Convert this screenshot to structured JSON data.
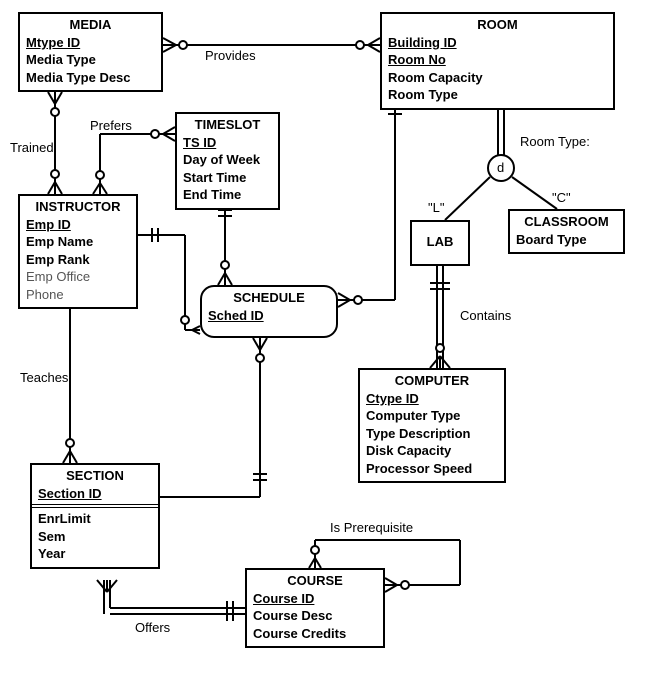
{
  "entities": {
    "media": {
      "title": "MEDIA",
      "pk": "Mtype ID",
      "attrs": [
        "Media Type",
        "Media Type Desc"
      ]
    },
    "room": {
      "title": "ROOM",
      "pk1": "Building ID",
      "pk2": "Room No",
      "attrs": [
        "Room Capacity",
        "Room Type"
      ]
    },
    "timeslot": {
      "title": "TIMESLOT",
      "pk": "TS ID",
      "attrs": [
        "Day of Week",
        "Start Time",
        "End Time"
      ]
    },
    "instructor": {
      "title": "INSTRUCTOR",
      "pk": "Emp ID",
      "attrs": [
        "Emp Name",
        "Emp Rank"
      ],
      "opt": "Emp Office Phone"
    },
    "schedule": {
      "title": "SCHEDULE",
      "pk": "Sched ID"
    },
    "lab": {
      "title": "LAB"
    },
    "classroom": {
      "title": "CLASSROOM",
      "attr": "Board Type"
    },
    "computer": {
      "title": "COMPUTER",
      "pk": "Ctype ID",
      "attrs": [
        "Computer Type",
        "Type Description",
        "Disk Capacity",
        "Processor Speed"
      ]
    },
    "section": {
      "title": "SECTION",
      "pk": "Section ID",
      "attrs": [
        "EnrLimit",
        "Sem",
        "Year"
      ]
    },
    "course": {
      "title": "COURSE",
      "pk": "Course ID",
      "attrs": [
        "Course Desc",
        "Course Credits"
      ]
    }
  },
  "relationships": {
    "provides": "Provides",
    "trained": "Trained",
    "prefers": "Prefers",
    "teaches": "Teaches",
    "offers": "Offers",
    "contains": "Contains",
    "is_prerequisite": "Is Prerequisite",
    "room_type_discriminator": "Room Type:",
    "lab_label": "\"L\"",
    "classroom_label": "\"C\"",
    "d_symbol": "d"
  }
}
